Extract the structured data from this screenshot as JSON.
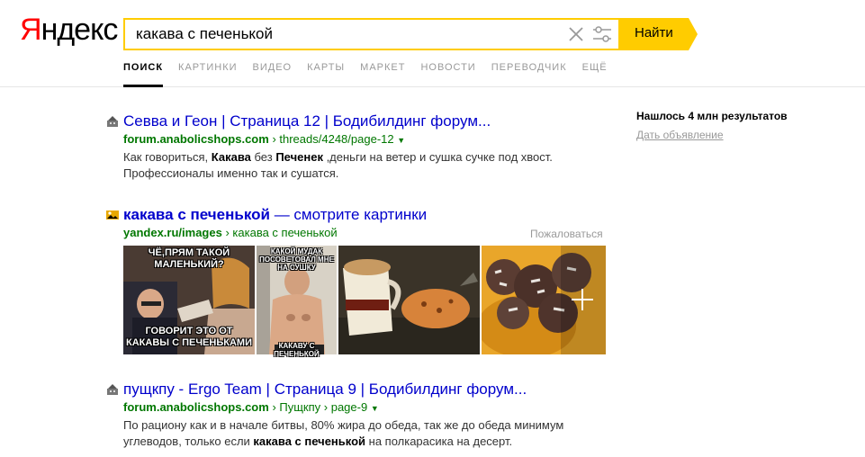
{
  "logo": {
    "first": "Я",
    "rest": "ндекс"
  },
  "search": {
    "query": "какава с печенькой",
    "button_label": "Найти"
  },
  "tabs": [
    {
      "label": "ПОИСК"
    },
    {
      "label": "КАРТИНКИ"
    },
    {
      "label": "ВИДЕО"
    },
    {
      "label": "КАРТЫ"
    },
    {
      "label": "МАРКЕТ"
    },
    {
      "label": "НОВОСТИ"
    },
    {
      "label": "ПЕРЕВОДЧИК"
    },
    {
      "label": "ЕЩЁ"
    }
  ],
  "results": [
    {
      "title": "Севва и Геон | Страница 12 | Бодибилдинг форум...",
      "domain": "forum.anabolicshops.com",
      "path": "threads/4248/page-12",
      "snippet": {
        "p1": "Как говориться, ",
        "b1": "Какава",
        "p2": " без ",
        "b2": "Печенек",
        "p3": " ,деньги на ветер и сушка сучке под хвост. Профессионалы именно так и сушатся."
      }
    },
    {
      "title_bold": "какава с печенькой",
      "title_rest": " — смотрите картинки",
      "domain": "yandex.ru/images",
      "path": "какава с печенькой",
      "complain": "Пожаловаться",
      "captions": {
        "t1_top": "ЧЁ,ПРЯМ ТАКОЙ МАЛЕНЬКИЙ?",
        "t1_bottom": "ГОВОРИТ ЭТО ОТ КАКАВЫ С ПЕЧЕНЬКАМИ",
        "t2_top": "КАКОЙ МУДАК ПОСОВЕТОВАЛ МНЕ НА СУШКУ",
        "t2_bottom": "КАКАВУ С ПЕЧЕНЬКОЙ"
      }
    },
    {
      "title": "пущкпу - Ergo Team | Страница 9 | Бодибилдинг форум...",
      "domain": "forum.anabolicshops.com",
      "path": "Пущкпу › page-9",
      "snippet": {
        "p1": "По рациону как и в начале битвы, 80% жира до обеда, так же до обеда минимум углеводов, только если ",
        "b1": "какава с печенькой",
        "p2": " на полкарасика на десерт."
      }
    }
  ],
  "aside": {
    "found": "Нашлось 4 млн результатов",
    "ad_link": "Дать объявление"
  },
  "colors": {
    "accent": "#ffcc00",
    "link": "#0000cc",
    "url": "#007700"
  }
}
